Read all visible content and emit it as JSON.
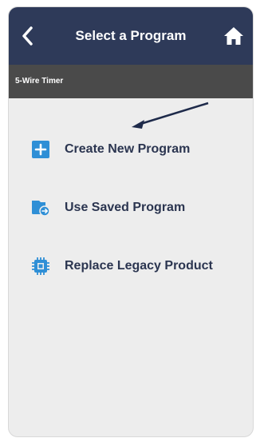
{
  "header": {
    "title": "Select a Program",
    "back_icon": "chevron-left-icon",
    "home_icon": "home-icon",
    "background": "#2e3a59"
  },
  "subheader": {
    "label": "5-Wire Timer",
    "background": "#4a4a4a"
  },
  "menu": {
    "items": [
      {
        "label": "Create New Program",
        "icon": "plus-square-icon"
      },
      {
        "label": "Use Saved Program",
        "icon": "saved-file-icon"
      },
      {
        "label": "Replace Legacy Product",
        "icon": "chip-icon"
      }
    ],
    "accent": "#2f8fd6"
  },
  "annotation": {
    "icon": "arrow-icon",
    "color": "#1e2a4a"
  }
}
